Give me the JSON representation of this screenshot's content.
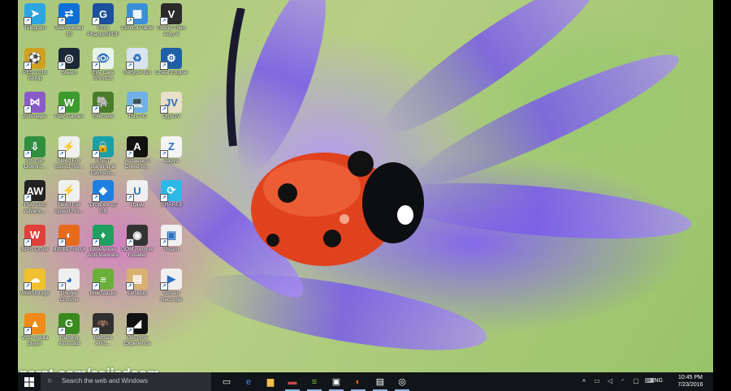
{
  "desktop_icons": [
    {
      "label": "Telegram",
      "icon": "telegram-icon",
      "color": "#2ca5e0",
      "glyph": "➤"
    },
    {
      "label": "TeamViewer 10",
      "icon": "teamviewer-icon",
      "color": "#0e6fd8",
      "glyph": "⇄"
    },
    {
      "label": "Foxit PhantomPDF",
      "icon": "foxit-pdf-icon",
      "color": "#1c4f9c",
      "glyph": "G"
    },
    {
      "label": "Control Panel",
      "icon": "control-panel-icon",
      "color": "#3a8fd6",
      "glyph": "▦"
    },
    {
      "label": "Grand Theft Auto V",
      "icon": "gta-icon",
      "color": "#2a2a2a",
      "glyph": "V"
    },
    {
      "label": "PES 2016 Setup",
      "icon": "pes-icon",
      "color": "#d0a020",
      "glyph": "⚽"
    },
    {
      "label": "Steam",
      "icon": "steam-icon",
      "color": "#1b2838",
      "glyph": "◎"
    },
    {
      "label": "Eye Care Shortcut",
      "icon": "eye-care-icon",
      "color": "#e8f4e8",
      "glyph": "👁"
    },
    {
      "label": "Recycle Bin",
      "icon": "recycle-bin-icon",
      "color": "#d9e4ee",
      "glyph": "♻"
    },
    {
      "label": "Cheat Engine",
      "icon": "cheat-engine-icon",
      "color": "#1f5fa6",
      "glyph": "⚙"
    },
    {
      "label": "ZenPlayer",
      "icon": "zenplayer-icon",
      "color": "#8a5cc8",
      "glyph": "⋈"
    },
    {
      "label": "Play Games",
      "icon": "play-games-icon",
      "color": "#3c9a2e",
      "glyph": "W"
    },
    {
      "label": "Evernote",
      "icon": "evernote-icon",
      "color": "#4a7c2a",
      "glyph": "🐘"
    },
    {
      "label": "This PC",
      "icon": "this-pc-icon",
      "color": "#6fb0e8",
      "glyph": "💻"
    },
    {
      "label": "OgreJV",
      "icon": "ogrejv-icon",
      "color": "#e8e0c8",
      "glyph": "JV"
    },
    {
      "label": "Internet Downlo...",
      "icon": "internet-download-icon",
      "color": "#2f8f3f",
      "glyph": "⇩"
    },
    {
      "label": "Need For Speed Riv...",
      "icon": "nfs-icon",
      "color": "#f0f0f0",
      "glyph": "⚡"
    },
    {
      "label": "ESET Banking & Payment...",
      "icon": "eset-icon",
      "color": "#1aa0a8",
      "glyph": "🔒"
    },
    {
      "label": "Assassin's Creed IV...",
      "icon": "assassins-creed-icon",
      "color": "#111111",
      "glyph": "A"
    },
    {
      "label": "Zapya",
      "icon": "zapya-icon",
      "color": "#f4f4f4",
      "glyph": "Z"
    },
    {
      "label": "Play Goo Advanc...",
      "icon": "play-goo-icon",
      "color": "#222222",
      "glyph": "AW"
    },
    {
      "label": "Need For Speed Riv...",
      "icon": "nfs2-icon",
      "color": "#f0f0f0",
      "glyph": "⚡"
    },
    {
      "label": "Dropbox 25 GB",
      "icon": "dropbox-icon",
      "color": "#1f7fe0",
      "glyph": "◆"
    },
    {
      "label": "Uplay",
      "icon": "uplay-icon",
      "color": "#f0f0f0",
      "glyph": "U"
    },
    {
      "label": "SHAREit",
      "icon": "shareit-icon",
      "color": "#2fb8e6",
      "glyph": "⟳"
    },
    {
      "label": "WPS Office",
      "icon": "wps-icon",
      "color": "#e0403a",
      "glyph": "W"
    },
    {
      "label": "Mozilla Firefox",
      "icon": "firefox-icon",
      "color": "#e56a1c",
      "glyph": "◐"
    },
    {
      "label": "Bitdefender Anti-Malware",
      "icon": "bitdefender-icon",
      "color": "#20a060",
      "glyph": "♦"
    },
    {
      "label": "GOM Remote Installer",
      "icon": "gom-icon",
      "color": "#333333",
      "glyph": "◉"
    },
    {
      "label": "Picam",
      "icon": "picam-icon",
      "color": "#f0f0f0",
      "glyph": "▣"
    },
    {
      "label": "WebStorage",
      "icon": "webstorage-icon",
      "color": "#f0c030",
      "glyph": "☁"
    },
    {
      "label": "Google Chrome",
      "icon": "chrome-icon",
      "color": "#f0f0f0",
      "glyph": "◕"
    },
    {
      "label": "BlueStacks",
      "icon": "bluestacks-icon",
      "color": "#6ab03a",
      "glyph": "≡"
    },
    {
      "label": "Desktop",
      "icon": "desktop-folder-icon",
      "color": "#d8b070",
      "glyph": "▤"
    },
    {
      "label": "Screen Recorder",
      "icon": "screen-recorder-icon",
      "color": "#f0f0f0",
      "glyph": "▶"
    },
    {
      "label": "VLC media player",
      "icon": "vlc-icon",
      "color": "#f08a18",
      "glyph": "▲"
    },
    {
      "label": "Gaming Assistant",
      "icon": "gaming-assistant-icon",
      "color": "#3a8a20",
      "glyph": "G"
    },
    {
      "label": "Batman Arkh...",
      "icon": "batman-icon",
      "color": "#303030",
      "glyph": "🦇"
    },
    {
      "label": "GeForce Experience",
      "icon": "geforce-icon",
      "color": "#111111",
      "glyph": "◢"
    }
  ],
  "watermark": "aparat.com/sajjadcom",
  "taskbar": {
    "search_placeholder": "Search the web and Windows",
    "apps": [
      {
        "name": "task-view-icon",
        "glyph": "▭",
        "color": "#ffffff"
      },
      {
        "name": "edge-icon",
        "glyph": "e",
        "color": "#3a8ee6"
      },
      {
        "name": "file-explorer-icon",
        "glyph": "▆",
        "color": "#f2c14e"
      },
      {
        "name": "media-player-icon",
        "glyph": "▬",
        "color": "#c74a4a"
      },
      {
        "name": "bluestacks-taskbar-icon",
        "glyph": "≡",
        "color": "#7bc043"
      },
      {
        "name": "store-icon",
        "glyph": "▣",
        "color": "#ffffff"
      },
      {
        "name": "firefox-taskbar-icon",
        "glyph": "◐",
        "color": "#e56a1c"
      },
      {
        "name": "screen-recorder-taskbar-icon",
        "glyph": "▤",
        "color": "#ffffff"
      },
      {
        "name": "obs-icon",
        "glyph": "◎",
        "color": "#ffffff"
      }
    ],
    "tray": {
      "language": "ENG",
      "time": "10:45 PM",
      "date": "7/23/2016"
    }
  }
}
